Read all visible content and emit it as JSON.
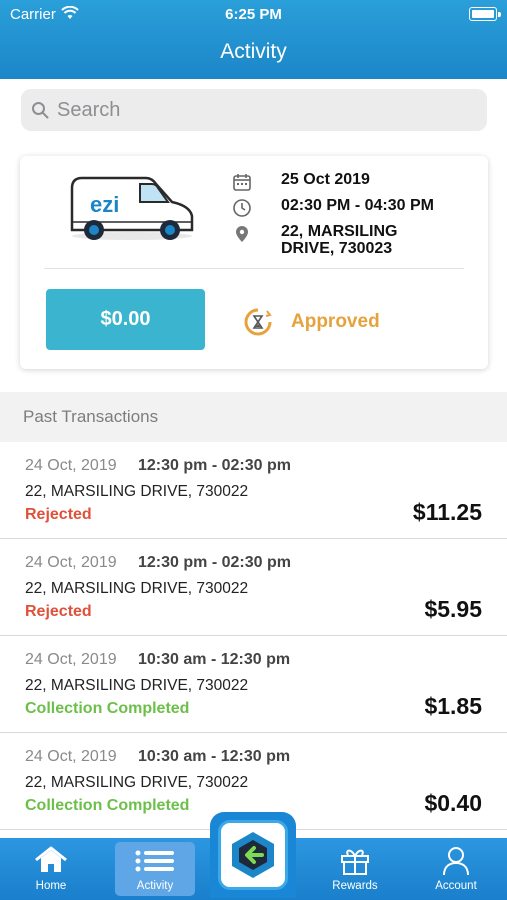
{
  "status_bar": {
    "carrier": "Carrier",
    "time": "6:25 PM"
  },
  "header": {
    "title": "Activity"
  },
  "search": {
    "placeholder": "Search"
  },
  "current_booking": {
    "van_brand": "ezi",
    "date": "25 Oct 2019",
    "time_range": "02:30 PM - 04:30 PM",
    "address_line1": "22, MARSILING",
    "address_line2": "DRIVE, 730023",
    "amount": "$0.00",
    "status": "Approved",
    "status_color": "#e6a33d"
  },
  "past": {
    "header": "Past Transactions",
    "transactions": [
      {
        "date": "24 Oct, 2019",
        "time_range": "12:30 pm - 02:30 pm",
        "address": "22, MARSILING DRIVE, 730022",
        "status": "Rejected",
        "amount": "$11.25"
      },
      {
        "date": "24 Oct, 2019",
        "time_range": "12:30 pm - 02:30 pm",
        "address": "22, MARSILING DRIVE, 730022",
        "status": "Rejected",
        "amount": "$5.95"
      },
      {
        "date": "24 Oct, 2019",
        "time_range": "10:30 am - 12:30 pm",
        "address": "22, MARSILING DRIVE, 730022",
        "status": "Collection Completed",
        "amount": "$1.85"
      },
      {
        "date": "24 Oct, 2019",
        "time_range": "10:30 am - 12:30 pm",
        "address": "22, MARSILING DRIVE, 730022",
        "status": "Collection Completed",
        "amount": "$0.40"
      }
    ]
  },
  "status_colors": {
    "Rejected": "#e0513b",
    "Collection Completed": "#6cc04a"
  },
  "tabs": [
    {
      "label": "Home",
      "icon": "home-icon"
    },
    {
      "label": "Activity",
      "icon": "list-icon",
      "active": true
    },
    {
      "label": "Rewards",
      "icon": "gift-icon"
    },
    {
      "label": "Account",
      "icon": "user-icon"
    }
  ]
}
